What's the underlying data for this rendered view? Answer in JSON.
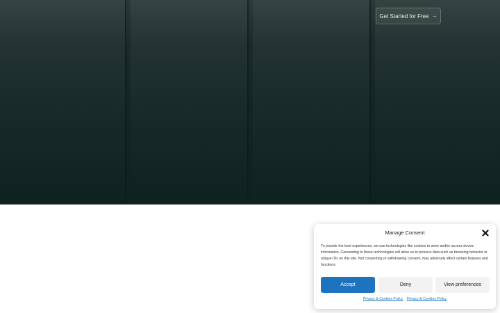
{
  "hero": {
    "cta_label": "Get Started for Free",
    "cta_icon": "arrow-right-icon"
  },
  "consent": {
    "title": "Manage Consent",
    "close_icon": "close-icon",
    "body": "To provide the best experiences, we use technologies like cookies to store and/or access device information. Consenting to these technologies will allow us to process data such as browsing behavior or unique IDs on this site. Not consenting or withdrawing consent, may adversely affect certain features and functions.",
    "buttons": {
      "accept": "Accept",
      "deny": "Deny",
      "preferences": "View preferences"
    },
    "links": [
      "Privacy & Cookies Policy",
      "Privacy & Cookies Policy"
    ],
    "accent_color": "#1e73be"
  }
}
